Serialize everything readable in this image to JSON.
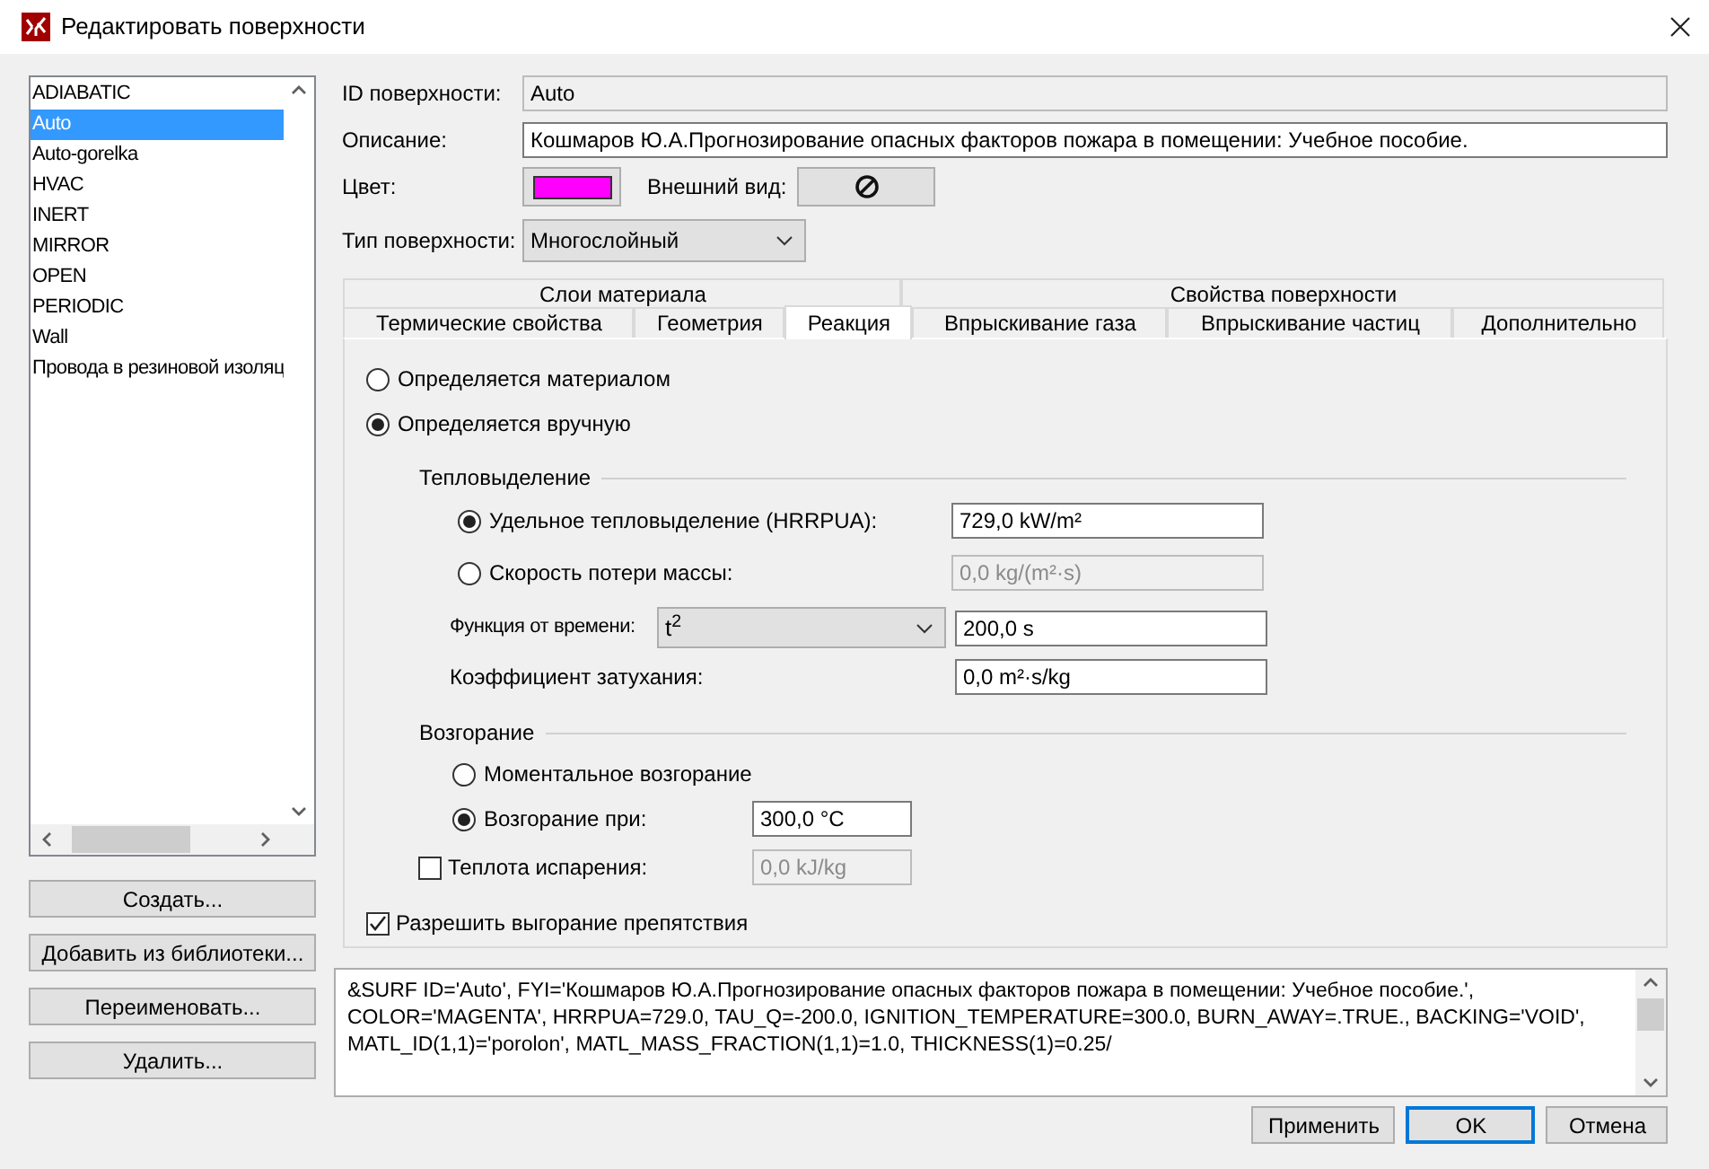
{
  "window": {
    "title": "Редактировать поверхности"
  },
  "surface_list": {
    "items": [
      {
        "label": "ADIABATIC",
        "selected": false
      },
      {
        "label": "Auto",
        "selected": true
      },
      {
        "label": "Auto-gorelka",
        "selected": false
      },
      {
        "label": "HVAC",
        "selected": false
      },
      {
        "label": "INERT",
        "selected": false
      },
      {
        "label": "MIRROR",
        "selected": false
      },
      {
        "label": "OPEN",
        "selected": false
      },
      {
        "label": "PERIODIC",
        "selected": false
      },
      {
        "label": "Wall",
        "selected": false
      },
      {
        "label": "Провода в резиновой изоляц",
        "selected": false
      }
    ]
  },
  "list_buttons": [
    "Создать...",
    "Добавить из библиотеки...",
    "Переименовать...",
    "Удалить..."
  ],
  "form": {
    "id_label": "ID поверхности:",
    "id_value": "Auto",
    "description_label": "Описание:",
    "description_value": "Кошмаров Ю.А.Прогнозирование опасных факторов пожара в помещении: Учебное пособие.",
    "color_label": "Цвет:",
    "color": "#ff00ff",
    "appearance_label": "Внешний вид:",
    "surface_type_label": "Тип поверхности:",
    "surface_type_value": "Многослойный"
  },
  "tabs": {
    "row_1": [
      {
        "label": "Слои материала",
        "selected": false
      },
      {
        "label": "Свойства поверхности",
        "selected": false
      }
    ],
    "row_2": [
      {
        "label": "Термические свойства",
        "selected": false
      },
      {
        "label": "Геометрия",
        "selected": false
      },
      {
        "label": "Реакция",
        "selected": true
      },
      {
        "label": "Впрыскивание газа",
        "selected": false
      },
      {
        "label": "Впрыскивание частиц",
        "selected": false
      },
      {
        "label": "Дополнительно",
        "selected": false
      }
    ]
  },
  "reaction": {
    "source": [
      {
        "label": "Определяется материалом",
        "selected": false
      },
      {
        "label": "Определяется вручную",
        "selected": true
      }
    ],
    "heat_release": {
      "title": "Тепловыделение",
      "options": [
        {
          "label": "Удельное тепловыделение (HRRPUA):",
          "selected": true,
          "value": "729,0 kW/m²",
          "disabled": false
        },
        {
          "label": "Скорость потери массы:",
          "selected": false,
          "value": "0,0 kg/(m²·s)",
          "disabled": true
        }
      ],
      "time_function": {
        "label": "Функция от времени:",
        "value": "t$^{2}$",
        "ramp": "200,0 s"
      },
      "decay": {
        "label": "Коэффициент затухания:",
        "value": "0,0 m²·s/kg"
      }
    },
    "ignition": {
      "title": "Возгорание",
      "options": [
        {
          "label": "Моментальное возгорание",
          "selected": false
        },
        {
          "label": "Возгорание при:",
          "selected": true,
          "value": "300,0 °C"
        }
      ],
      "vaporization": {
        "label": "Теплота испарения:",
        "checked": false,
        "value": "0,0 kJ/kg",
        "disabled": true
      }
    },
    "burn_away": {
      "label": "Разрешить выгорание препятствия",
      "checked": true
    }
  },
  "fds_text": "&SURF ID='Auto', FYI='Кошмаров Ю.А.Прогнозирование опасных факторов пожара в помещении: Учебное пособие.', COLOR='MAGENTA', HRRPUA=729.0, TAU_Q=-200.0, IGNITION_TEMPERATURE=300.0, BURN_AWAY=.TRUE., BACKING='VOID', MATL_ID(1,1)='porolon', MATL_MASS_FRACTION(1,1)=1.0, THICKNESS(1)=0.25/",
  "buttons": [
    {
      "label": "Применить",
      "selected": false
    },
    {
      "label": "OK",
      "selected": true
    },
    {
      "label": "Отмена",
      "selected": false
    }
  ]
}
